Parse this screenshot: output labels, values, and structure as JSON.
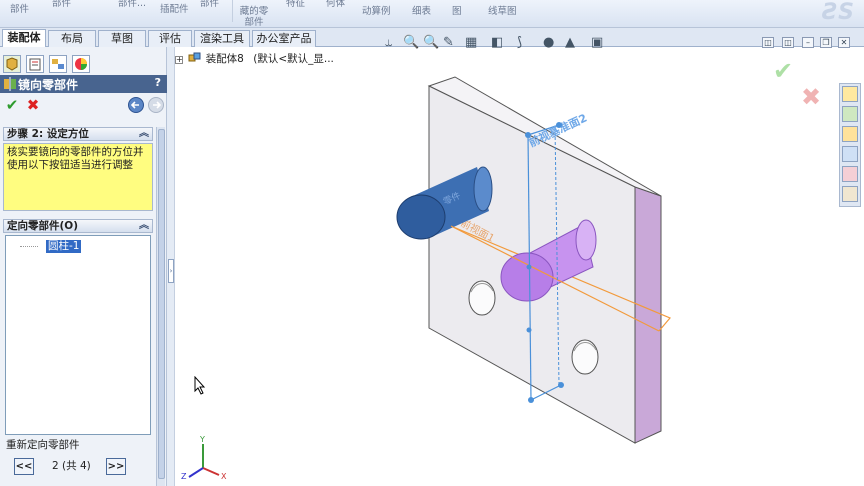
{
  "ribbon": {
    "items": [
      "部件",
      "部件",
      "部件...",
      "插配件",
      "部件",
      "藏的零部件",
      "特征",
      "何体",
      "动算例",
      "细表",
      "图",
      "线草图"
    ]
  },
  "tabs": [
    "装配体",
    "布局",
    "草图",
    "评估",
    "渲染工具",
    "办公室产品"
  ],
  "panel": {
    "title": "镜向零部件",
    "help": "?",
    "step_header": "步骤 2: 设定方位",
    "message": "核实要镜向的零部件的方位并使用以下按钮适当进行调整",
    "oriented_header": "定向零部件(O)",
    "list_items": [
      "圆柱-1"
    ],
    "reorient_label": "重新定向零部件",
    "counter": "2 (共 4)",
    "prev": "<<",
    "next": ">>"
  },
  "tree": {
    "name": "装配体8",
    "config": "(默认<默认_显..."
  },
  "scene": {
    "plane_label": "前视基准面2",
    "plane_label_back": "前视面1",
    "axis_y": "Y",
    "axis_x": "X",
    "axis_z": "Z"
  },
  "colors": {
    "panel_title_bg": "#48648f",
    "message_bg": "#fffd80",
    "selected_item": "#316ac5",
    "accent_blue": "#4a90d9",
    "plate": "#ece9ee",
    "cylinder_blue": "#2f5d9e",
    "cylinder_purple": "#b77ee8",
    "plane_orange": "#f29a3c"
  }
}
